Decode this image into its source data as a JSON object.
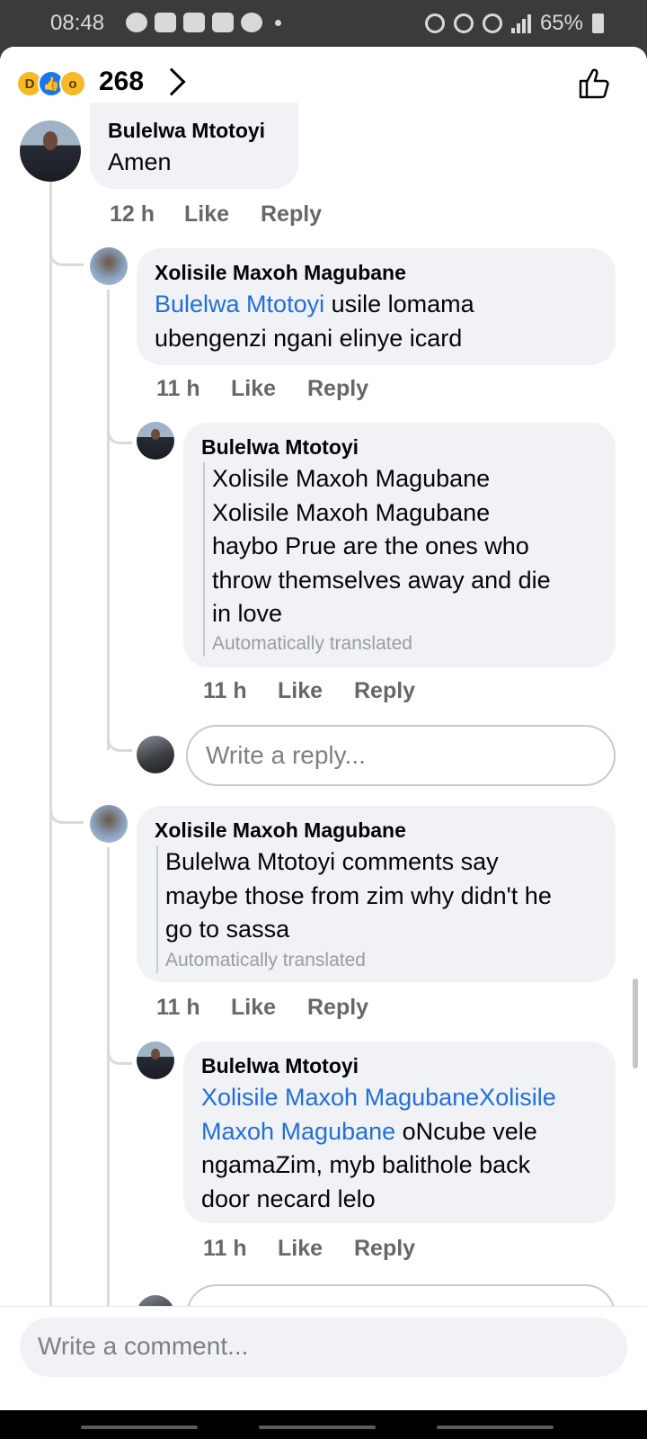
{
  "status_bar": {
    "time": "08:48",
    "battery": "65%"
  },
  "header": {
    "reactions": [
      "haha-icon",
      "like-icon",
      "wow-icon"
    ],
    "reaction_count": "268"
  },
  "comments": [
    {
      "author": "Bulelwa Mtotoyi",
      "text": "Amen",
      "time": "12 h",
      "like": "Like",
      "reply": "Reply"
    },
    {
      "author": "Xolisile Maxoh Magubane",
      "mention": "Bulelwa Mtotoyi",
      "text_line1": " usile lomama",
      "text_line2": "ubengenzi ngani elinye icard",
      "time": "11 h",
      "like": "Like",
      "reply": "Reply"
    },
    {
      "author": "Bulelwa Mtotoyi",
      "lines": [
        "Xolisile Maxoh Magubane",
        "Xolisile Maxoh Magubane",
        "haybo Prue are the ones who",
        "throw themselves away and die",
        "in love"
      ],
      "note": "Automatically translated",
      "time": "11 h",
      "like": "Like",
      "reply": "Reply"
    },
    {
      "author": "Xolisile Maxoh Magubane",
      "lines": [
        "Bulelwa Mtotoyi comments say",
        "maybe those from zim why didn't he",
        "go to sassa"
      ],
      "note": "Automatically translated",
      "time": "11 h",
      "like": "Like",
      "reply": "Reply"
    },
    {
      "author": "Bulelwa Mtotoyi",
      "mention_line1": "Xolisile Maxoh MagubaneXolisile",
      "mention_line2": "Maxoh Magubane",
      "text_line2": " oNcube vele",
      "text_line3": "ngamaZim, myb balithole back",
      "text_line4": "door necard lelo",
      "time": "11 h",
      "like": "Like",
      "reply": "Reply"
    }
  ],
  "reply_input": {
    "placeholder": "Write a reply..."
  },
  "composer": {
    "placeholder": "Write a comment..."
  },
  "colors": {
    "mention": "#216fdb",
    "bubble": "#f0f2f5",
    "meta": "#65676b"
  }
}
